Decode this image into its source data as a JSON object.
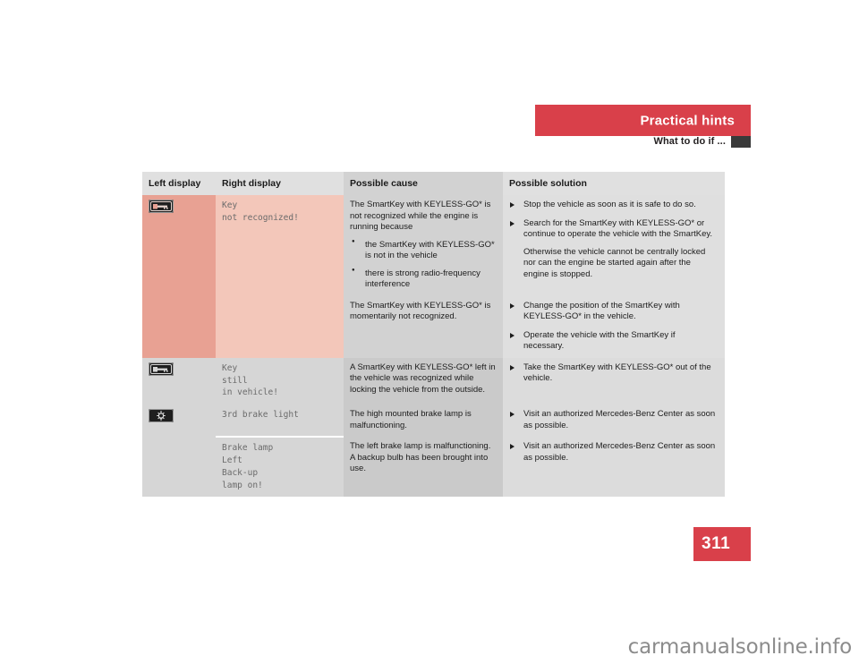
{
  "header": {
    "chapter_title": "Practical hints",
    "section_title": "What to do if ...",
    "banner_color": "#d9404a"
  },
  "page": {
    "number": "311",
    "watermark": "carmanualsonline.info"
  },
  "table": {
    "columns": [
      {
        "key": "left",
        "label": "Left display"
      },
      {
        "key": "right",
        "label": "Right display"
      },
      {
        "key": "cause",
        "label": "Possible cause"
      },
      {
        "key": "sol",
        "label": "Possible solution"
      }
    ],
    "rows": [
      {
        "id": "key-not-recognized",
        "tint": "alert",
        "icon": "key-telltale-icon",
        "left_display": "",
        "right_display": "Key\nnot recognized!",
        "cause_intro": "The SmartKey with KEYLESS-GO* is not recognized while the engine is running because",
        "cause_bullets": [
          "the SmartKey with KEYLESS-GO* is not in the vehicle",
          "there is strong radio-frequency interference"
        ],
        "solution_bullets": [
          "Stop the vehicle as soon as it is safe to do so.",
          "Search for the SmartKey with KEYLESS-GO* or continue to operate the vehicle with the SmartKey."
        ],
        "solution_note": "Otherwise the vehicle cannot be centrally locked nor can the engine be started again after the engine is stopped."
      },
      {
        "id": "key-momentarily-not-recognized",
        "tint": "alert",
        "icon": "",
        "left_display": "",
        "right_display": "",
        "cause_intro": "The SmartKey with KEYLESS-GO* is momentarily not recognized.",
        "cause_bullets": [],
        "solution_bullets": [
          "Change the position of the SmartKey with KEYLESS-GO* in the vehicle.",
          "Operate the vehicle with the SmartKey if necessary."
        ],
        "solution_note": ""
      },
      {
        "id": "key-still-in-vehicle",
        "tint": "norm",
        "icon": "key-telltale-icon",
        "left_display": "",
        "right_display": "Key\nstill\nin vehicle!",
        "cause_intro": "A SmartKey with KEYLESS-GO* left in the vehicle was recognized while locking the vehicle from the outside.",
        "cause_bullets": [],
        "solution_bullets": [
          "Take the SmartKey with KEYLESS-GO* out of the vehicle."
        ],
        "solution_note": ""
      },
      {
        "id": "third-brake-light",
        "tint": "norm",
        "icon": "brake-lamp-telltale-icon",
        "left_display": "",
        "right_display": "3rd brake light",
        "cause_intro": "The high mounted brake lamp is malfunctioning.",
        "cause_bullets": [],
        "solution_bullets": [
          "Visit an authorized Mercedes-Benz Center as soon as possible."
        ],
        "solution_note": ""
      },
      {
        "id": "brake-lamp-left-backup",
        "tint": "norm",
        "icon": "",
        "left_display": "",
        "right_display": "Brake lamp\nLeft\nBack-up\nlamp on!",
        "cause_intro": "The left brake lamp is malfunctioning. A backup bulb has been brought into use.",
        "cause_bullets": [],
        "solution_bullets": [
          "Visit an authorized Mercedes-Benz Center as soon as possible."
        ],
        "solution_note": ""
      }
    ]
  }
}
